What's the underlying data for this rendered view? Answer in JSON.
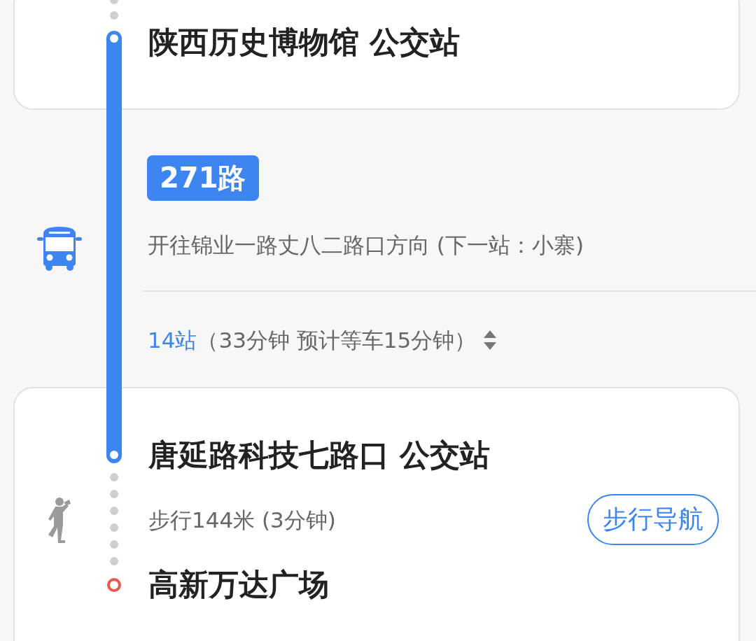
{
  "boarding_stop": {
    "name": "陕西历史博物馆 公交站"
  },
  "bus": {
    "line": "271路",
    "direction": "开往锦业一路丈八二路口方向 (下一站：小寨)",
    "stops": "14站",
    "duration": "（33分钟 预计等车15分钟）"
  },
  "alight_stop": {
    "name": "唐延路科技七路口 公交站"
  },
  "walk": {
    "info": "步行144米 (3分钟)",
    "button": "步行导航"
  },
  "destination": {
    "name": "高新万达广场"
  }
}
